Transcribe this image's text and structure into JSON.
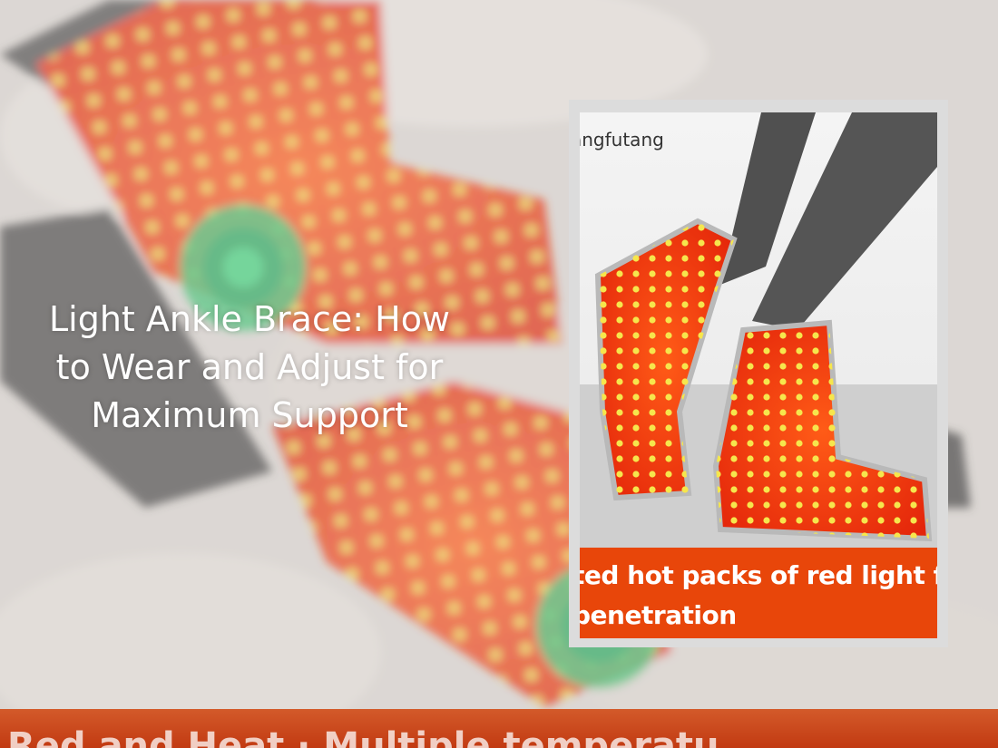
{
  "hero": {
    "title": "Light Ankle Brace: How to Wear and Adjust for Maximum Support"
  },
  "product_image": {
    "brand_text": "angfutang",
    "banner_line1": "ted hot packs of red light for",
    "banner_line2": "penetration"
  },
  "background_strip": {
    "text": "Red and Heat · Multiple temperatu"
  },
  "colors": {
    "heat_pad": "#e8350f",
    "heat_dot": "#f4e04a",
    "banner": "#e8460a",
    "sock_gray": "#4a4a4a",
    "green_icon": "#2fbf6a"
  }
}
